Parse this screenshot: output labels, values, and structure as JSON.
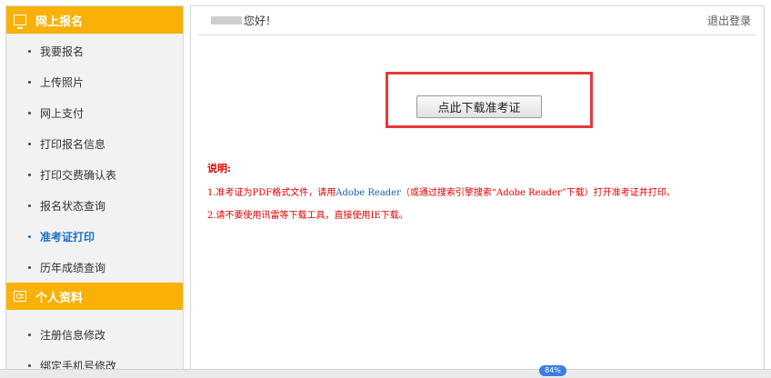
{
  "sidebar": {
    "online": {
      "title": "网上报名",
      "icon": "monitor-icon",
      "items": [
        {
          "label": "我要报名"
        },
        {
          "label": "上传照片"
        },
        {
          "label": "网上支付"
        },
        {
          "label": "打印报名信息"
        },
        {
          "label": "打印交费确认表"
        },
        {
          "label": "报名状态查询"
        },
        {
          "label": "准考证打印",
          "active": true
        },
        {
          "label": "历年成绩查询"
        }
      ]
    },
    "profile": {
      "title": "个人资料",
      "icon": "id-card-icon",
      "items": [
        {
          "label": "注册信息修改"
        },
        {
          "label": "绑定手机号修改"
        }
      ]
    }
  },
  "header": {
    "greeting": "您好！",
    "logout": "退出登录"
  },
  "main": {
    "download_button": "点此下载准考证",
    "notes_title": "说明:",
    "note1_prefix": "1.准考证为PDF格式文件，请用",
    "note1_link": "Adobe Reader",
    "note1_suffix": "（或通过搜索引擎搜索“Adobe Reader”下载）打开准考证并打印。",
    "note2": "2.请不要使用讯雷等下载工具，直接使用IE下载。"
  },
  "bottom": {
    "tag": "84%"
  },
  "colors": {
    "accent": "#f9b107",
    "active_link": "#1a6fc9",
    "note_red": "#e00000",
    "highlight_border": "#e5383b"
  }
}
